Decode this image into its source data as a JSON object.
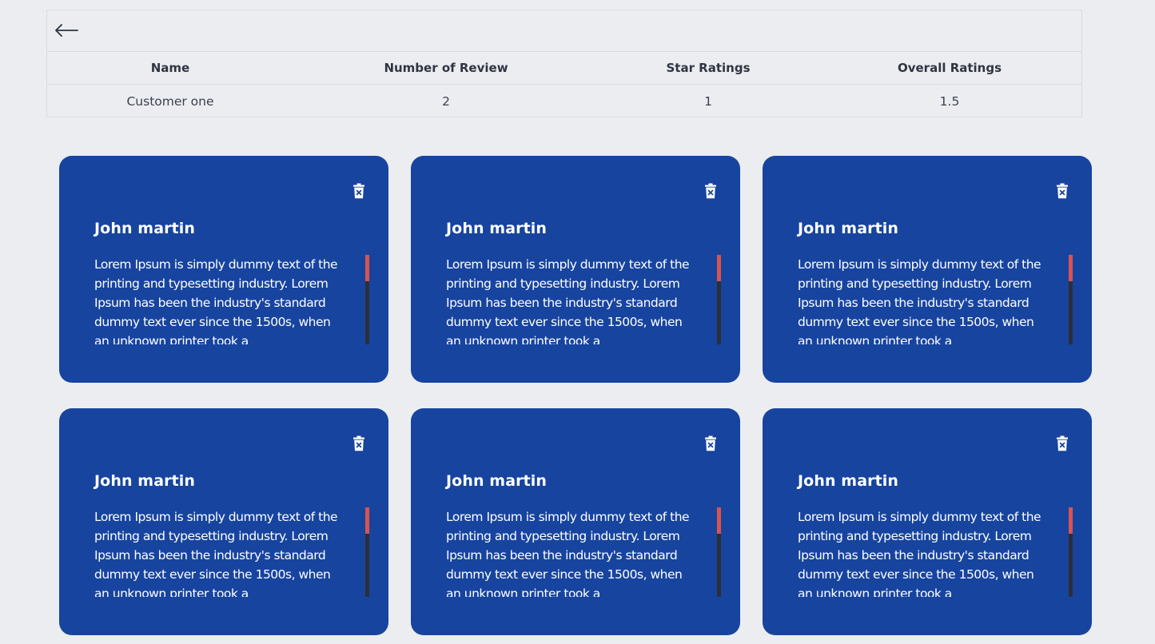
{
  "table": {
    "headers": [
      "Name",
      "Number of Review",
      "Star Ratings",
      "Overall Ratings"
    ],
    "row": {
      "name": "Customer one",
      "reviews": "2",
      "stars": "1",
      "overall": "1.5"
    }
  },
  "reviews": [
    {
      "name": "John martin",
      "text": "Lorem Ipsum is simply dummy text of the printing and typesetting industry. Lorem Ipsum has been the industry's standard dummy text ever since the 1500s, when an unknown printer took a"
    },
    {
      "name": "John martin",
      "text": "Lorem Ipsum is simply dummy text of the printing and typesetting industry. Lorem Ipsum has been the industry's standard dummy text ever since the 1500s, when an unknown printer took a"
    },
    {
      "name": "John martin",
      "text": "Lorem Ipsum is simply dummy text of the printing and typesetting industry. Lorem Ipsum has been the industry's standard dummy text ever since the 1500s, when an unknown printer took a"
    },
    {
      "name": "John martin",
      "text": "Lorem Ipsum is simply dummy text of the printing and typesetting industry. Lorem Ipsum has been the industry's standard dummy text ever since the 1500s, when an unknown printer took a"
    },
    {
      "name": "John martin",
      "text": "Lorem Ipsum is simply dummy text of the printing and typesetting industry. Lorem Ipsum has been the industry's standard dummy text ever since the 1500s, when an unknown printer took a"
    },
    {
      "name": "John martin",
      "text": "Lorem Ipsum is simply dummy text of the printing and typesetting industry. Lorem Ipsum has been the industry's standard dummy text ever since the 1500s, when an unknown printer took a"
    }
  ],
  "icons": {
    "back": "arrow-left-icon",
    "delete": "trash-icon"
  },
  "colors": {
    "card": "#17449f",
    "background": "#ebedf0",
    "scroll_thumb": "#d9534f",
    "scroll_track": "#2b2f3a"
  }
}
